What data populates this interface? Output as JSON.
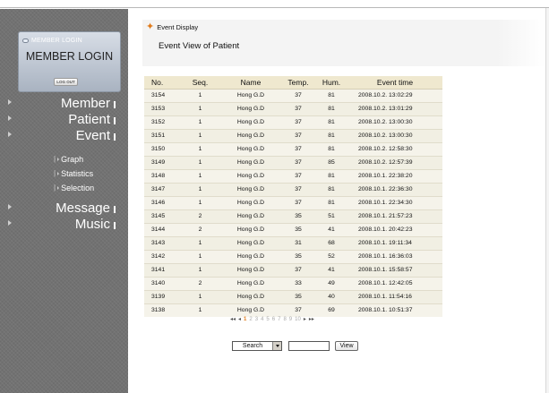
{
  "sidebar": {
    "login_small": "MEMBER LOGIN",
    "login_title": "MEMBER LOGIN",
    "logout_label": "LOG OUT",
    "nav": [
      {
        "label": "Member"
      },
      {
        "label": "Patient"
      },
      {
        "label": "Event"
      }
    ],
    "sub_nav": [
      {
        "label": "Graph"
      },
      {
        "label": "Statistics"
      },
      {
        "label": "Selection"
      }
    ],
    "nav_bottom": [
      {
        "label": "Message"
      },
      {
        "label": "Music"
      }
    ]
  },
  "header": {
    "section_label": "Event Display",
    "title": "Event View of Patient"
  },
  "table": {
    "columns": [
      "No.",
      "Seq.",
      "Name",
      "Temp.",
      "Hum.",
      "Event time"
    ],
    "rows": [
      [
        "3154",
        "1",
        "Hong G.D",
        "37",
        "81",
        "2008.10.2.  13:02:29"
      ],
      [
        "3153",
        "1",
        "Hong G.D",
        "37",
        "81",
        "2008.10.2.  13:01:29"
      ],
      [
        "3152",
        "1",
        "Hong G.D",
        "37",
        "81",
        "2008.10.2.  13:00:30"
      ],
      [
        "3151",
        "1",
        "Hong G.D",
        "37",
        "81",
        "2008.10.2.  13:00:30"
      ],
      [
        "3150",
        "1",
        "Hong G.D",
        "37",
        "81",
        "2008.10.2.  12:58:30"
      ],
      [
        "3149",
        "1",
        "Hong G.D",
        "37",
        "85",
        "2008.10.2.  12:57:39"
      ],
      [
        "3148",
        "1",
        "Hong G.D",
        "37",
        "81",
        "2008.10.1.  22:38:20"
      ],
      [
        "3147",
        "1",
        "Hong G.D",
        "37",
        "81",
        "2008.10.1.  22:36:30"
      ],
      [
        "3146",
        "1",
        "Hong G.D",
        "37",
        "81",
        "2008.10.1.  22:34:30"
      ],
      [
        "3145",
        "2",
        "Hong G.D",
        "35",
        "51",
        "2008.10.1.  21:57:23"
      ],
      [
        "3144",
        "2",
        "Hong G.D",
        "35",
        "41",
        "2008.10.1.  20:42:23"
      ],
      [
        "3143",
        "1",
        "Hong G.D",
        "31",
        "68",
        "2008.10.1.  19:11:34"
      ],
      [
        "3142",
        "1",
        "Hong G.D",
        "35",
        "52",
        "2008.10.1.  16:36:03"
      ],
      [
        "3141",
        "1",
        "Hong G.D",
        "37",
        "41",
        "2008.10.1.  15:58:57"
      ],
      [
        "3140",
        "2",
        "Hong G.D",
        "33",
        "49",
        "2008.10.1.  12:42:05"
      ],
      [
        "3139",
        "1",
        "Hong G.D",
        "35",
        "40",
        "2008.10.1.  11:54:16"
      ],
      [
        "3138",
        "1",
        "Hong G.D",
        "37",
        "69",
        "2008.10.1.  10:51:37"
      ]
    ]
  },
  "pagination": {
    "first": "◂◂",
    "prev": "◂",
    "pages": [
      "1",
      "2",
      "3",
      "4",
      "5",
      "6",
      "7",
      "8",
      "9",
      "10"
    ],
    "current": "1",
    "next": "▸",
    "last": "▸▸"
  },
  "search": {
    "select_value": "Search",
    "input_value": "",
    "view_label": "View"
  },
  "colors": {
    "accent": "#e07a1a",
    "sidebar_bg": "#727272",
    "table_header_bg": "#efe8cf"
  },
  "icons": {
    "header_icon": "event-display-icon"
  }
}
